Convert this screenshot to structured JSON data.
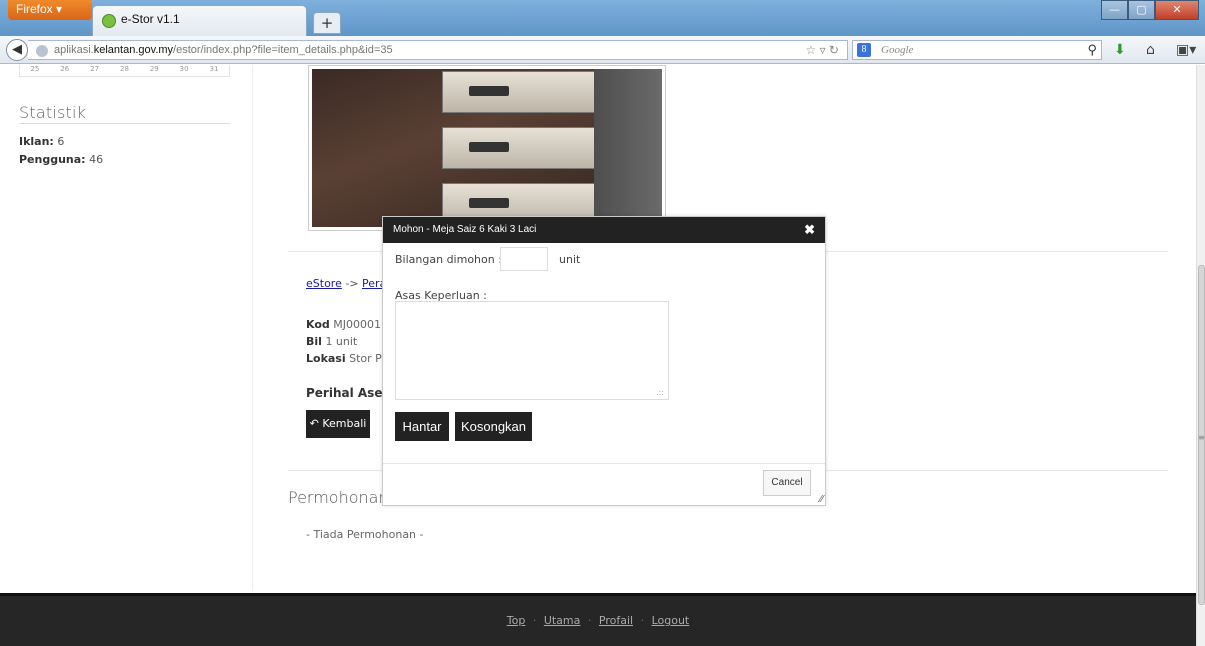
{
  "browser": {
    "app_button": "Firefox ▾",
    "tab_title": "e-Stor v1.1",
    "new_tab": "+",
    "url_prefix": "aplikasi.",
    "url_domain": "kelantan.gov.my",
    "url_path": "/estor/index.php?file=item_details.php&id=35",
    "search_placeholder": "Google",
    "search_engine_icon": "google-icon"
  },
  "sidebar": {
    "calendar_remnant": [
      "25",
      "26",
      "27",
      "28",
      "29",
      "30",
      "31"
    ],
    "stat_title": "Statistik",
    "stats": [
      {
        "label": "Iklan:",
        "value": "6"
      },
      {
        "label": "Pengguna:",
        "value": "46"
      }
    ]
  },
  "item": {
    "breadcrumb_root": "eStore",
    "breadcrumb_sep": "->",
    "breadcrumb_next": "Pera",
    "kod_label": "Kod",
    "kod_value": "MJ00001",
    "bil_label": "Bil",
    "bil_value": "1 unit",
    "lokasi_label": "Lokasi",
    "lokasi_value": "Stor Pe",
    "perihal": "Perihal Aset ",
    "back_button": "Kembali"
  },
  "permohonan": {
    "title": "Permohonan",
    "empty": "- Tiada Permohonan -"
  },
  "dialog": {
    "title": "Mohon - Meja Saiz 6 Kaki 3 Laci",
    "bil_label": "Bilangan dimohon :",
    "bil_value": "",
    "unit": "unit",
    "asas_label": "Asas Keperluan :",
    "asas_value": "",
    "submit": "Hantar",
    "reset": "Kosongkan",
    "cancel": "Cancel"
  },
  "footer": {
    "links": [
      "Top",
      "Utama",
      "Profail",
      "Logout"
    ],
    "separator": "·"
  },
  "colors": {
    "dark": "#222222",
    "footer_bg": "#262626",
    "link": "#1a1aa6"
  }
}
